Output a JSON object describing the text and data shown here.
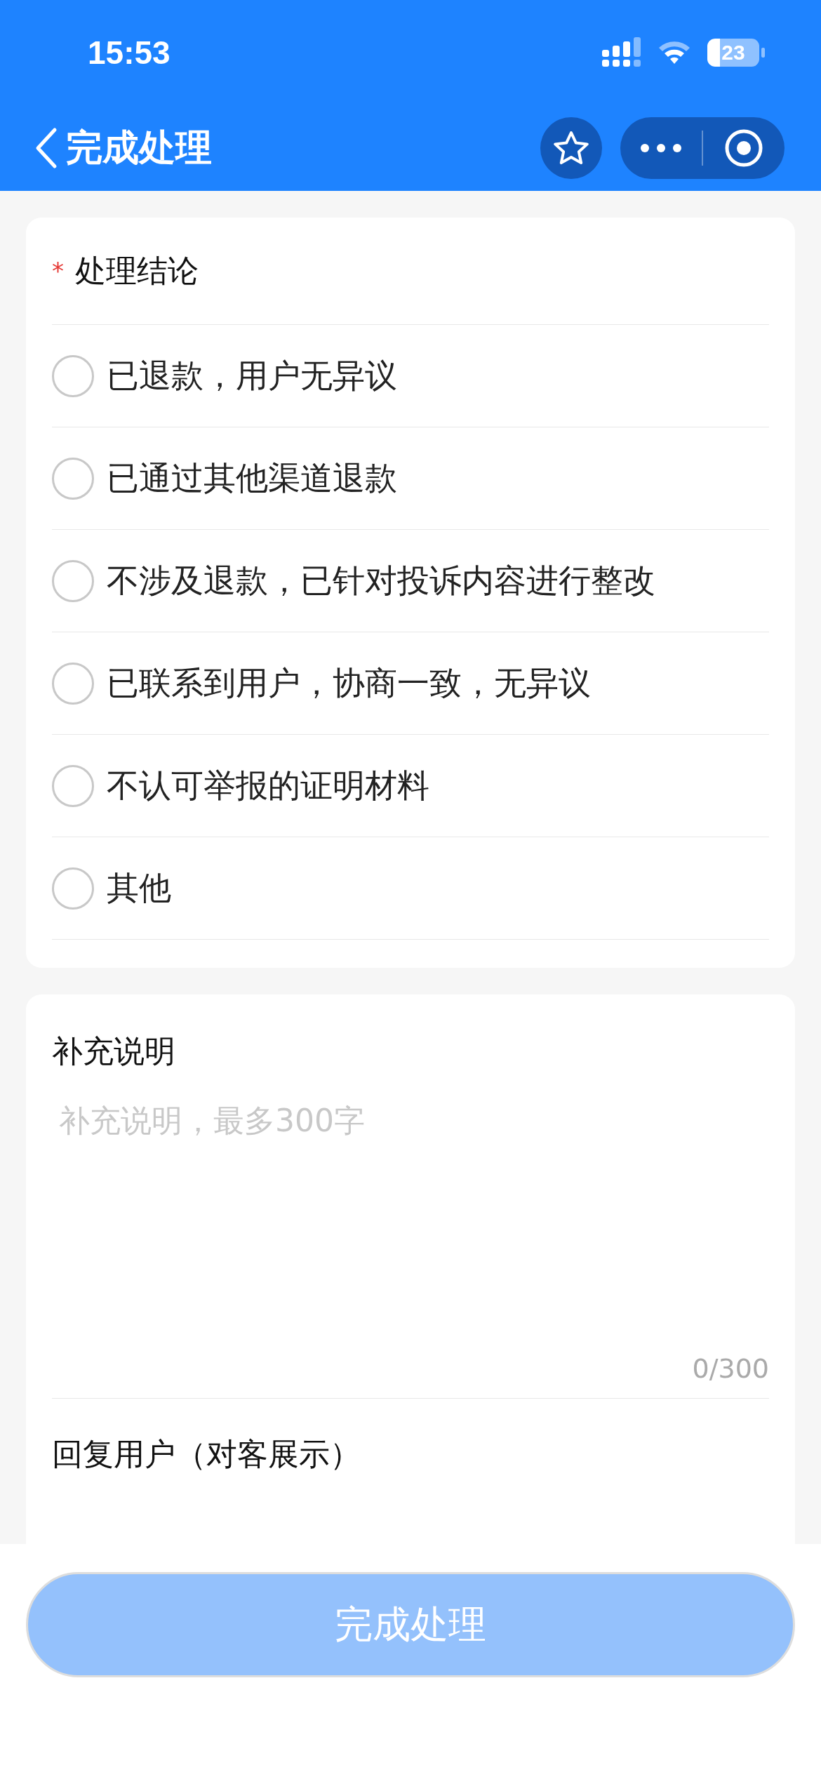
{
  "status_bar": {
    "time": "15:53",
    "battery": "23"
  },
  "nav": {
    "title": "完成处理"
  },
  "conclusion": {
    "required_mark": "*",
    "title": "处理结论",
    "options": [
      {
        "label": "已退款，用户无异议",
        "selected": false
      },
      {
        "label": "已通过其他渠道退款",
        "selected": false
      },
      {
        "label": "不涉及退款，已针对投诉内容进行整改",
        "selected": false
      },
      {
        "label": "已联系到用户，协商一致，无异议",
        "selected": false
      },
      {
        "label": "不认可举报的证明材料",
        "selected": false
      },
      {
        "label": "其他",
        "selected": false
      }
    ]
  },
  "supplement": {
    "title": "补充说明",
    "placeholder": "补充说明，最多300字",
    "counter": "0/300"
  },
  "reply": {
    "title": "回复用户（对客展示）"
  },
  "submit": {
    "label": "完成处理",
    "disabled": true
  }
}
